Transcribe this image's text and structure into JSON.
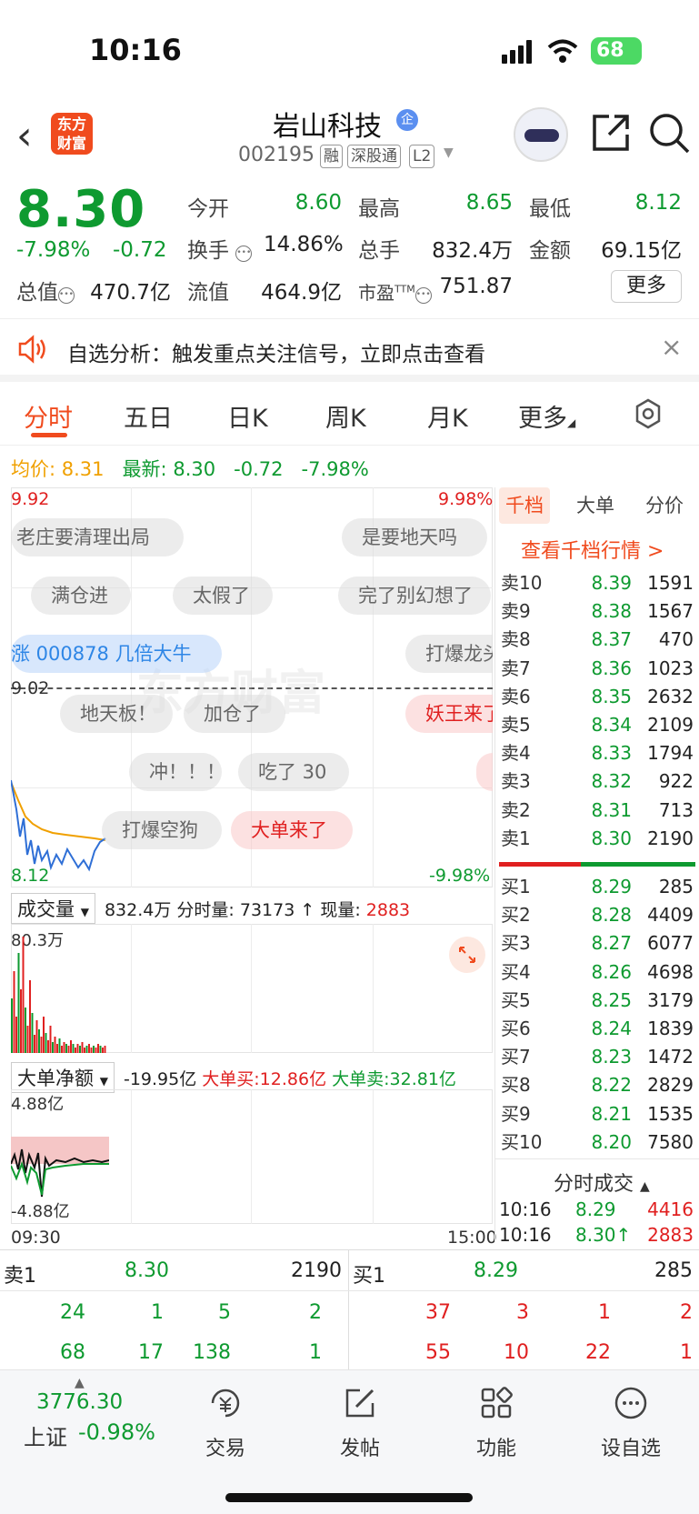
{
  "status_bar": {
    "time": "10:16",
    "battery": "68"
  },
  "header": {
    "logo_line1": "东方",
    "logo_line2": "财富",
    "stock_name": "岩山科技",
    "name_badge": "企",
    "stock_code": "002195",
    "tags": [
      "融",
      "深股通",
      "L2"
    ]
  },
  "quote": {
    "price": "8.30",
    "change_pct": "-7.98%",
    "change_amt": "-0.72",
    "open_label": "今开",
    "open": "8.60",
    "high_label": "最高",
    "high": "8.65",
    "low_label": "最低",
    "low": "8.12",
    "turnover_label": "换手",
    "turnover": "14.86%",
    "volume_label": "总手",
    "volume": "832.4万",
    "amount_label": "金额",
    "amount": "69.15亿",
    "mktcap_label": "总值",
    "mktcap": "470.7亿",
    "float_label": "流值",
    "float_cap": "464.9亿",
    "pe_label": "市盈",
    "pe_sup": "TTM",
    "pe": "751.87",
    "more_label": "更多"
  },
  "notice": {
    "text": "自选分析：触发重点关注信号，立即点击查看",
    "close": "×"
  },
  "tabs": [
    "分时",
    "五日",
    "日K",
    "周K",
    "月K",
    "更多"
  ],
  "price_line": {
    "avg_label": "均价:",
    "avg": "8.31",
    "last_label": "最新:",
    "last": "8.30",
    "chg": "-0.72",
    "pct": "-7.98%"
  },
  "chart": {
    "top_price": "9.92",
    "top_pct": "9.98%",
    "mid_price": "9.02",
    "bottom_price": "8.12",
    "bottom_pct": "-9.98%",
    "watermark": "东方财富",
    "start_time": "09:30",
    "end_time": "15:00",
    "danmu": [
      "老庄要清理出局",
      "是要地天吗",
      "满仓进",
      "太假了",
      "完了别幻想了",
      "涨 000878 几倍大牛",
      "打爆龙头",
      "地天板！",
      "加仓了",
      "妖王来了",
      "冲！！！",
      "吃了 30",
      "打爆空狗",
      "大单来了"
    ],
    "line_color": "#2f6fd6",
    "avg_color": "#f0a000"
  },
  "volume": {
    "selector": "成交量",
    "total": "832.4万",
    "minute_label": "分时量:",
    "minute_val": "73173",
    "now_label": "现量:",
    "now_val": "2883",
    "max_label": "80.3万"
  },
  "big_order": {
    "selector": "大单净额",
    "net": "-19.95亿",
    "buy_label": "大单买:",
    "buy": "12.86亿",
    "sell_label": "大单卖:",
    "sell": "32.81亿",
    "top_label": "4.88亿",
    "bottom_label": "-4.88亿"
  },
  "order_book": {
    "tabs": [
      "千档",
      "大单",
      "分价"
    ],
    "link": "查看千档行情 >",
    "asks": [
      {
        "label": "卖10",
        "price": "8.39",
        "vol": "1591"
      },
      {
        "label": "卖9",
        "price": "8.38",
        "vol": "1567"
      },
      {
        "label": "卖8",
        "price": "8.37",
        "vol": "470"
      },
      {
        "label": "卖7",
        "price": "8.36",
        "vol": "1023"
      },
      {
        "label": "卖6",
        "price": "8.35",
        "vol": "2632"
      },
      {
        "label": "卖5",
        "price": "8.34",
        "vol": "2109"
      },
      {
        "label": "卖4",
        "price": "8.33",
        "vol": "1794"
      },
      {
        "label": "卖3",
        "price": "8.32",
        "vol": "922"
      },
      {
        "label": "卖2",
        "price": "8.31",
        "vol": "713"
      },
      {
        "label": "卖1",
        "price": "8.30",
        "vol": "2190"
      }
    ],
    "bids": [
      {
        "label": "买1",
        "price": "8.29",
        "vol": "285"
      },
      {
        "label": "买2",
        "price": "8.28",
        "vol": "4409"
      },
      {
        "label": "买3",
        "price": "8.27",
        "vol": "6077"
      },
      {
        "label": "买4",
        "price": "8.26",
        "vol": "4698"
      },
      {
        "label": "买5",
        "price": "8.25",
        "vol": "3179"
      },
      {
        "label": "买6",
        "price": "8.24",
        "vol": "1839"
      },
      {
        "label": "买7",
        "price": "8.23",
        "vol": "1472"
      },
      {
        "label": "买8",
        "price": "8.22",
        "vol": "2829"
      },
      {
        "label": "买9",
        "price": "8.21",
        "vol": "1535"
      },
      {
        "label": "买10",
        "price": "8.20",
        "vol": "7580"
      }
    ],
    "ticks_title": "分时成交",
    "ticks": [
      {
        "time": "10:16",
        "price": "8.29",
        "vol": "4416"
      },
      {
        "time": "10:16",
        "price": "8.30↑",
        "vol": "2883"
      }
    ]
  },
  "bottom_quote": {
    "ask1_label": "卖1",
    "ask1_price": "8.30",
    "ask1_vol": "2190",
    "bid1_label": "买1",
    "bid1_price": "8.29",
    "bid1_vol": "285",
    "row1_left": [
      "24",
      "1",
      "5",
      "2"
    ],
    "row1_right": [
      "37",
      "3",
      "1",
      "2"
    ],
    "row2_left": [
      "68",
      "17",
      "138",
      "1"
    ],
    "row2_right": [
      "55",
      "10",
      "22",
      "1"
    ]
  },
  "bottom_nav": {
    "index_value": "3776.30",
    "index_name": "上证",
    "index_change": "-0.98%",
    "items": [
      "交易",
      "发帖",
      "功能",
      "设自选"
    ]
  }
}
